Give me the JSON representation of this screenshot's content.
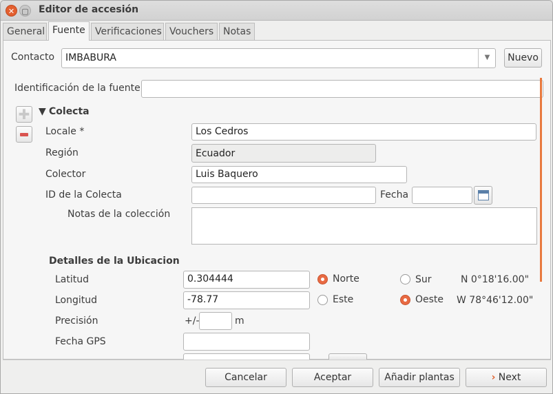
{
  "window": {
    "title": "Editor de accesión"
  },
  "tabs": [
    {
      "label": "General"
    },
    {
      "label": "Fuente"
    },
    {
      "label": "Verificaciones"
    },
    {
      "label": "Vouchers"
    },
    {
      "label": "Notas"
    }
  ],
  "contact": {
    "label": "Contacto",
    "value": "IMBABURA",
    "new_button": "Nuevo"
  },
  "source_id": {
    "label": "Identificación de la fuente",
    "value": ""
  },
  "collection": {
    "header": "Colecta",
    "locale": {
      "label": "Locale *",
      "value": "Los Cedros"
    },
    "region": {
      "label": "Región",
      "value": "Ecuador"
    },
    "collector": {
      "label": "Colector",
      "value": "Luis Baquero"
    },
    "collection_id": {
      "label": "ID de la Colecta",
      "value": ""
    },
    "date": {
      "label": "Fecha",
      "value": ""
    },
    "notes": {
      "label": "Notas de la colección",
      "value": ""
    }
  },
  "location": {
    "header": "Detalles de la Ubicacion",
    "latitude": {
      "label": "Latitud",
      "value": "0.304444",
      "north": "Norte",
      "south": "Sur",
      "readout": "N 0°18'16.00\""
    },
    "longitude": {
      "label": "Longitud",
      "value": "-78.77",
      "east": "Este",
      "west": "Oeste",
      "readout": "W 78°46'12.00\""
    },
    "precision": {
      "label": "Precisión",
      "prefix": "+/-",
      "value": "",
      "unit": "m"
    },
    "gps_date": {
      "label": "Fecha GPS",
      "value": ""
    }
  },
  "footer": {
    "cancel": "Cancelar",
    "accept": "Aceptar",
    "add_plants": "Añadir plantas",
    "next": "Next"
  },
  "colors": {
    "accent": "#e86a43",
    "scroll_indicator": "#e8793e",
    "remove_button": "#d9534f"
  },
  "icons": [
    "close-icon",
    "maximize-icon",
    "chevron-down-icon",
    "plus-icon",
    "minus-icon",
    "disclosure-triangle-icon",
    "calendar-icon",
    "chevron-right-icon"
  ]
}
